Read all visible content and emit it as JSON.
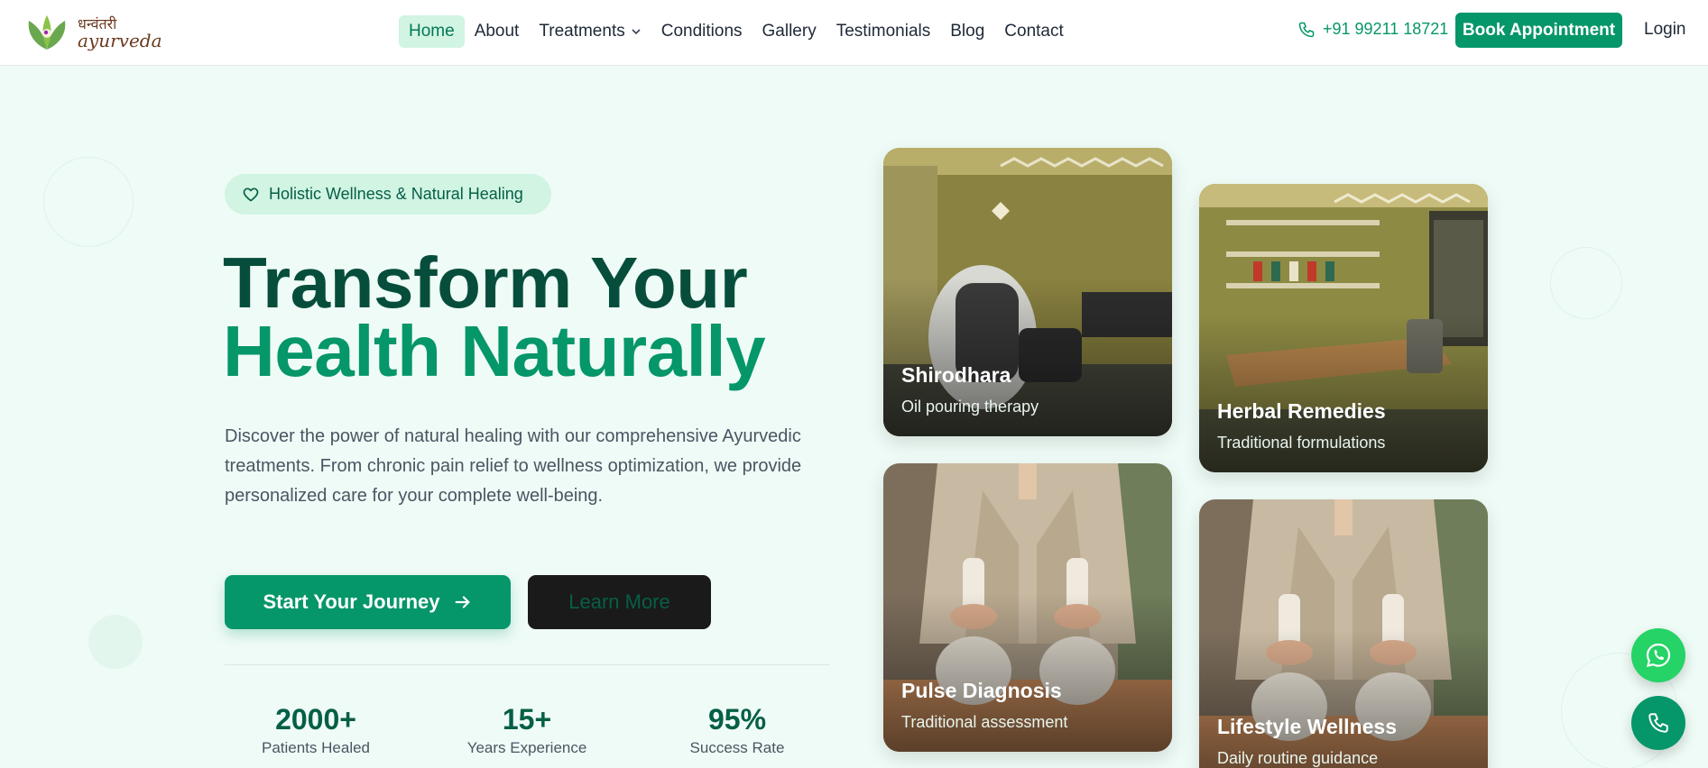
{
  "brand": {
    "logo_line1": "धन्वंतरी",
    "logo_line2": "ayurveda"
  },
  "nav": {
    "items": [
      {
        "label": "Home",
        "active": true
      },
      {
        "label": "About"
      },
      {
        "label": "Treatments",
        "has_dropdown": true
      },
      {
        "label": "Conditions"
      },
      {
        "label": "Gallery"
      },
      {
        "label": "Testimonials"
      },
      {
        "label": "Blog"
      },
      {
        "label": "Contact"
      }
    ]
  },
  "header": {
    "phone": "+91 99211 18721",
    "book_label": "Book Appointment",
    "login_label": "Login"
  },
  "hero": {
    "badge": "Holistic Wellness & Natural Healing",
    "title_line1": "Transform Your",
    "title_line2": "Health Naturally",
    "description": "Discover the power of natural healing with our comprehensive Ayurvedic treatments. From chronic pain relief to wellness optimization, we provide personalized care for your complete well-being.",
    "cta_primary": "Start Your Journey",
    "cta_secondary": "Learn More"
  },
  "stats": [
    {
      "value": "2000+",
      "label": "Patients Healed"
    },
    {
      "value": "15+",
      "label": "Years Experience"
    },
    {
      "value": "95%",
      "label": "Success Rate"
    }
  ],
  "cards": [
    {
      "title": "Shirodhara",
      "subtitle": "Oil pouring therapy"
    },
    {
      "title": "Herbal Remedies",
      "subtitle": "Traditional formulations"
    },
    {
      "title": "Pulse Diagnosis",
      "subtitle": "Traditional assessment"
    },
    {
      "title": "Lifestyle Wellness",
      "subtitle": "Daily routine guidance"
    }
  ],
  "colors": {
    "primary": "#059669",
    "dark_green": "#064e3b",
    "background": "#effbf6",
    "whatsapp": "#25d366"
  },
  "icons": {
    "phone": "phone-icon",
    "badge": "heart-icon",
    "arrow": "arrow-right-icon",
    "dropdown": "chevron-down-icon",
    "whatsapp": "whatsapp-icon",
    "call": "phone-call-icon"
  }
}
